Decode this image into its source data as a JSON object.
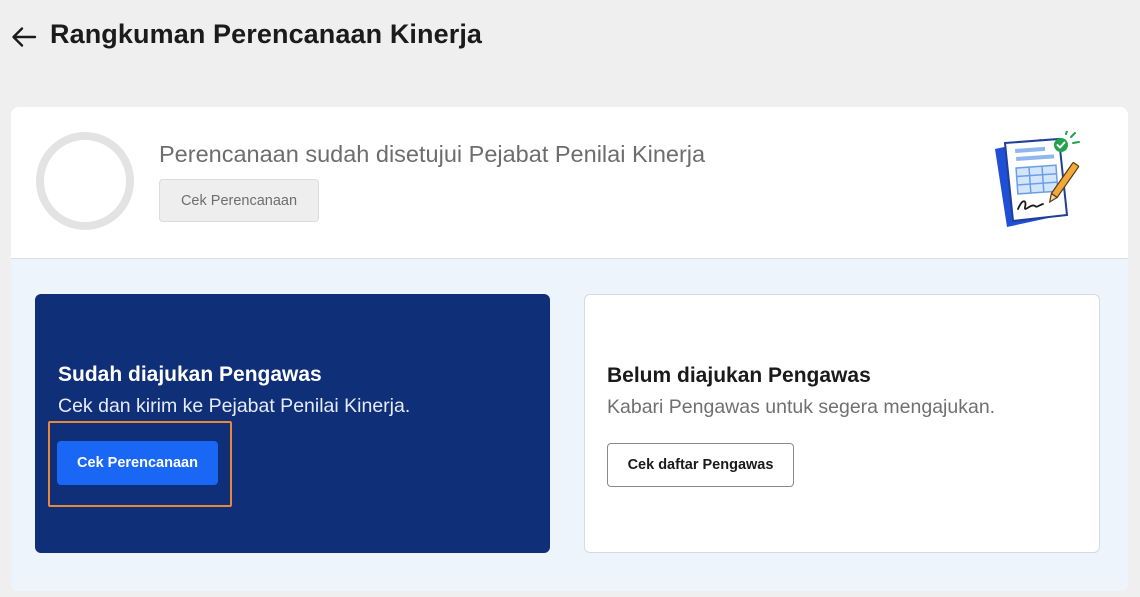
{
  "header": {
    "back_icon": "arrow-left-icon",
    "title": "Rangkuman Perencanaan Kinerja"
  },
  "status": {
    "title": "Perencanaan sudah disetujui Pejabat Penilai Kinerja",
    "check_button_label": "Cek Perencanaan",
    "illustration_icon": "document-signed-illustration"
  },
  "cards": {
    "submitted": {
      "heading": "Sudah diajukan Pengawas",
      "description": "Cek dan kirim ke Pejabat Penilai Kinerja.",
      "button_label": "Cek Perencanaan"
    },
    "pending": {
      "heading": "Belum diajukan Pengawas",
      "description": "Kabari Pengawas untuk segera mengajukan.",
      "button_label": "Cek daftar Pengawas"
    }
  },
  "colors": {
    "background": "#efefef",
    "card_dark": "#0f2f78",
    "primary_button": "#1a66f5",
    "highlight": "#e8893a",
    "lower_section": "#eef4fc"
  }
}
